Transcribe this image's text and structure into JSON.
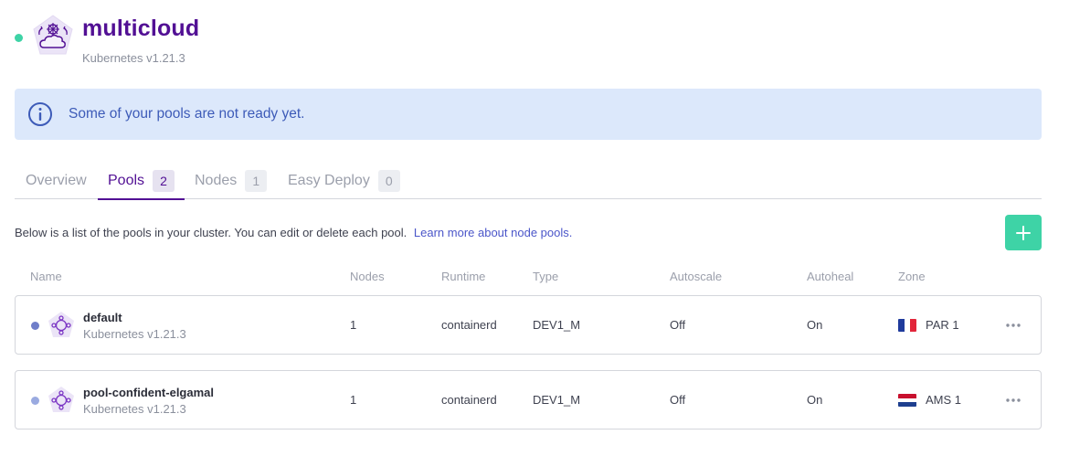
{
  "colors": {
    "brand": "#521094",
    "status_ok": "#3ed3a6",
    "alert_bg": "#dce8fb",
    "alert_text": "#3d5bb8",
    "add_button": "#3ed3a6",
    "pool_dot_default": "#6f7ec9",
    "pool_dot_2": "#9aaae0"
  },
  "cluster": {
    "name": "multicloud",
    "version": "Kubernetes v1.21.3",
    "logo_icon": "kubernetes-cloud-icon"
  },
  "alert": {
    "icon": "info-icon",
    "text": "Some of your pools are not ready yet."
  },
  "tabs": [
    {
      "label": "Overview",
      "count": null
    },
    {
      "label": "Pools",
      "count": "2"
    },
    {
      "label": "Nodes",
      "count": "1"
    },
    {
      "label": "Easy Deploy",
      "count": "0"
    }
  ],
  "pools_section": {
    "description": "Below is a list of the pools in your cluster. You can edit or delete each pool.",
    "learn_more": "Learn more about node pools.",
    "add_icon": "plus-icon"
  },
  "table": {
    "columns": [
      "Name",
      "Nodes",
      "Runtime",
      "Type",
      "Autoscale",
      "Autoheal",
      "Zone"
    ],
    "rows": [
      {
        "name": "default",
        "version": "Kubernetes v1.21.3",
        "nodes": "1",
        "runtime": "containerd",
        "type": "DEV1_M",
        "autoscale": "Off",
        "autoheal": "On",
        "zone": "PAR 1",
        "flag_icon": "france-flag-icon"
      },
      {
        "name": "pool-confident-elgamal",
        "version": "Kubernetes v1.21.3",
        "nodes": "1",
        "runtime": "containerd",
        "type": "DEV1_M",
        "autoscale": "Off",
        "autoheal": "On",
        "zone": "AMS 1",
        "flag_icon": "netherlands-flag-icon"
      }
    ]
  }
}
